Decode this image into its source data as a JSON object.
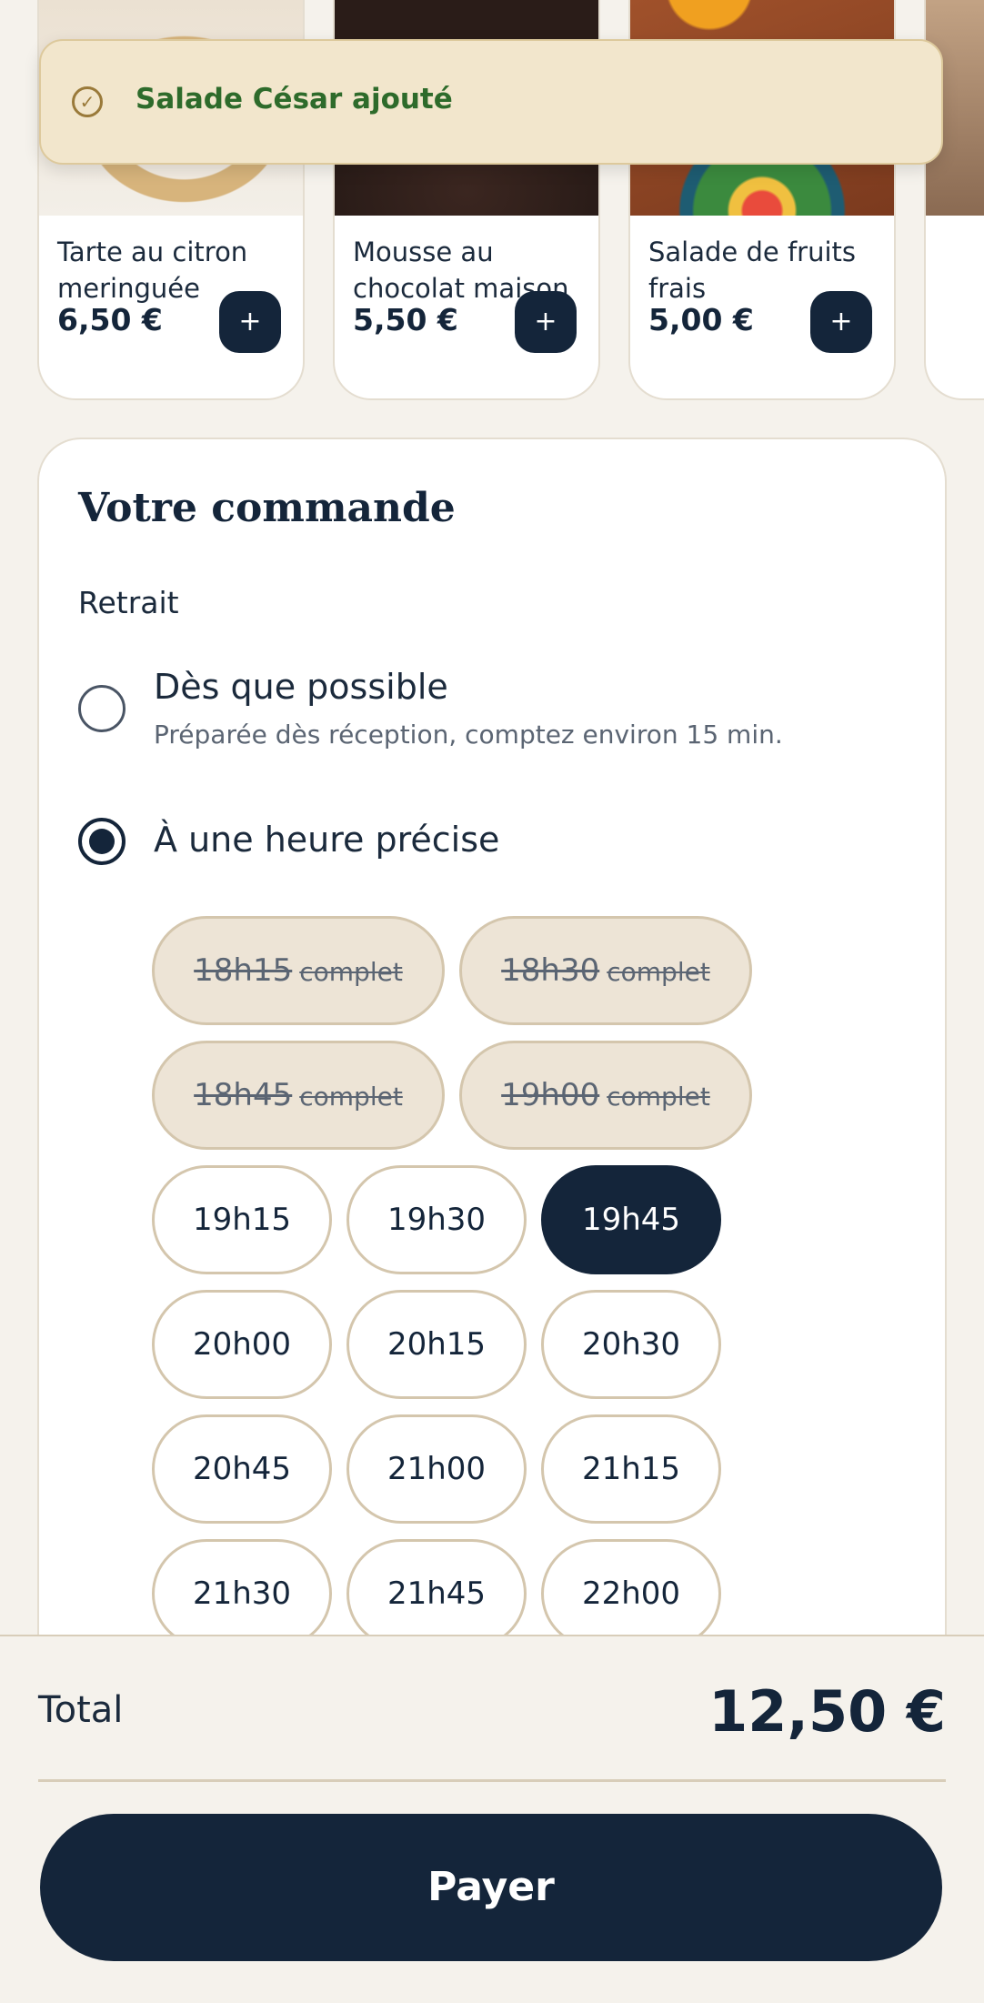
{
  "carousel": {
    "items": [
      {
        "name": "Tarte au citron meringuée",
        "price": "6,50 €",
        "add_label": "+"
      },
      {
        "name": "Mousse au chocolat maison",
        "price": "5,50 €",
        "add_label": "+"
      },
      {
        "name": "Salade de fruits frais",
        "price": "5,00 €",
        "add_label": "+"
      }
    ]
  },
  "toast": {
    "message": "Salade César ajouté",
    "icon": "check-circle-icon"
  },
  "order": {
    "title": "Votre commande",
    "section_label": "Retrait",
    "options": [
      {
        "label": "Dès que possible",
        "hint": "Préparée dès réception, comptez environ 15 min.",
        "checked": false
      },
      {
        "label": "À une heure précise",
        "checked": true
      }
    ],
    "slots": [
      {
        "time": "18h15",
        "status": "complet",
        "available": false
      },
      {
        "time": "18h30",
        "status": "complet",
        "available": false
      },
      {
        "time": "18h45",
        "status": "complet",
        "available": false
      },
      {
        "time": "19h00",
        "status": "complet",
        "available": false
      },
      {
        "time": "19h15",
        "available": true
      },
      {
        "time": "19h30",
        "available": true
      },
      {
        "time": "19h45",
        "available": true,
        "selected": true
      },
      {
        "time": "20h00",
        "available": true
      },
      {
        "time": "20h15",
        "available": true
      },
      {
        "time": "20h30",
        "available": true
      },
      {
        "time": "20h45",
        "available": true
      },
      {
        "time": "21h00",
        "available": true
      },
      {
        "time": "21h15",
        "available": true
      },
      {
        "time": "21h30",
        "available": true
      },
      {
        "time": "21h45",
        "available": true
      },
      {
        "time": "22h00",
        "available": true
      }
    ]
  },
  "footer": {
    "total_label": "Total",
    "total_value": "12,50 €",
    "pay_label": "Payer"
  },
  "colors": {
    "primary": "#14253a",
    "background": "#f5f2ec",
    "toast_bg": "#f2e6cc",
    "success_text": "#2e6b2b"
  }
}
